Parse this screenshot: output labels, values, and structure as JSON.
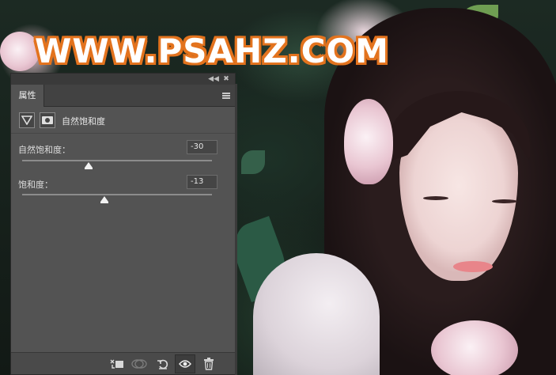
{
  "watermark": {
    "text": "WWW.PSAHZ.COM"
  },
  "panel": {
    "topbar": {
      "collapse_icon": "double-chevron-left-icon",
      "close_icon": "close-icon"
    },
    "tab_label": "属性",
    "menu_icon": "panel-menu-icon",
    "adjustment": {
      "title": "自然饱和度",
      "adjustment_icon": "triangle-down-icon",
      "mask_icon": "layer-mask-icon"
    },
    "params": [
      {
        "label": "自然饱和度：",
        "value": "-30",
        "min": -100,
        "max": 100
      },
      {
        "label": "饱和度：",
        "value": "-13",
        "min": -100,
        "max": 100
      }
    ],
    "footer": {
      "clip_icon": "clip-to-layer-icon",
      "view_previous_icon": "view-previous-state-icon",
      "reset_icon": "reset-icon",
      "visibility_icon": "eye-icon",
      "delete_icon": "trash-icon"
    }
  },
  "colors": {
    "panel_bg": "#535353",
    "panel_dark": "#424242",
    "watermark_outline": "#e3731e"
  }
}
